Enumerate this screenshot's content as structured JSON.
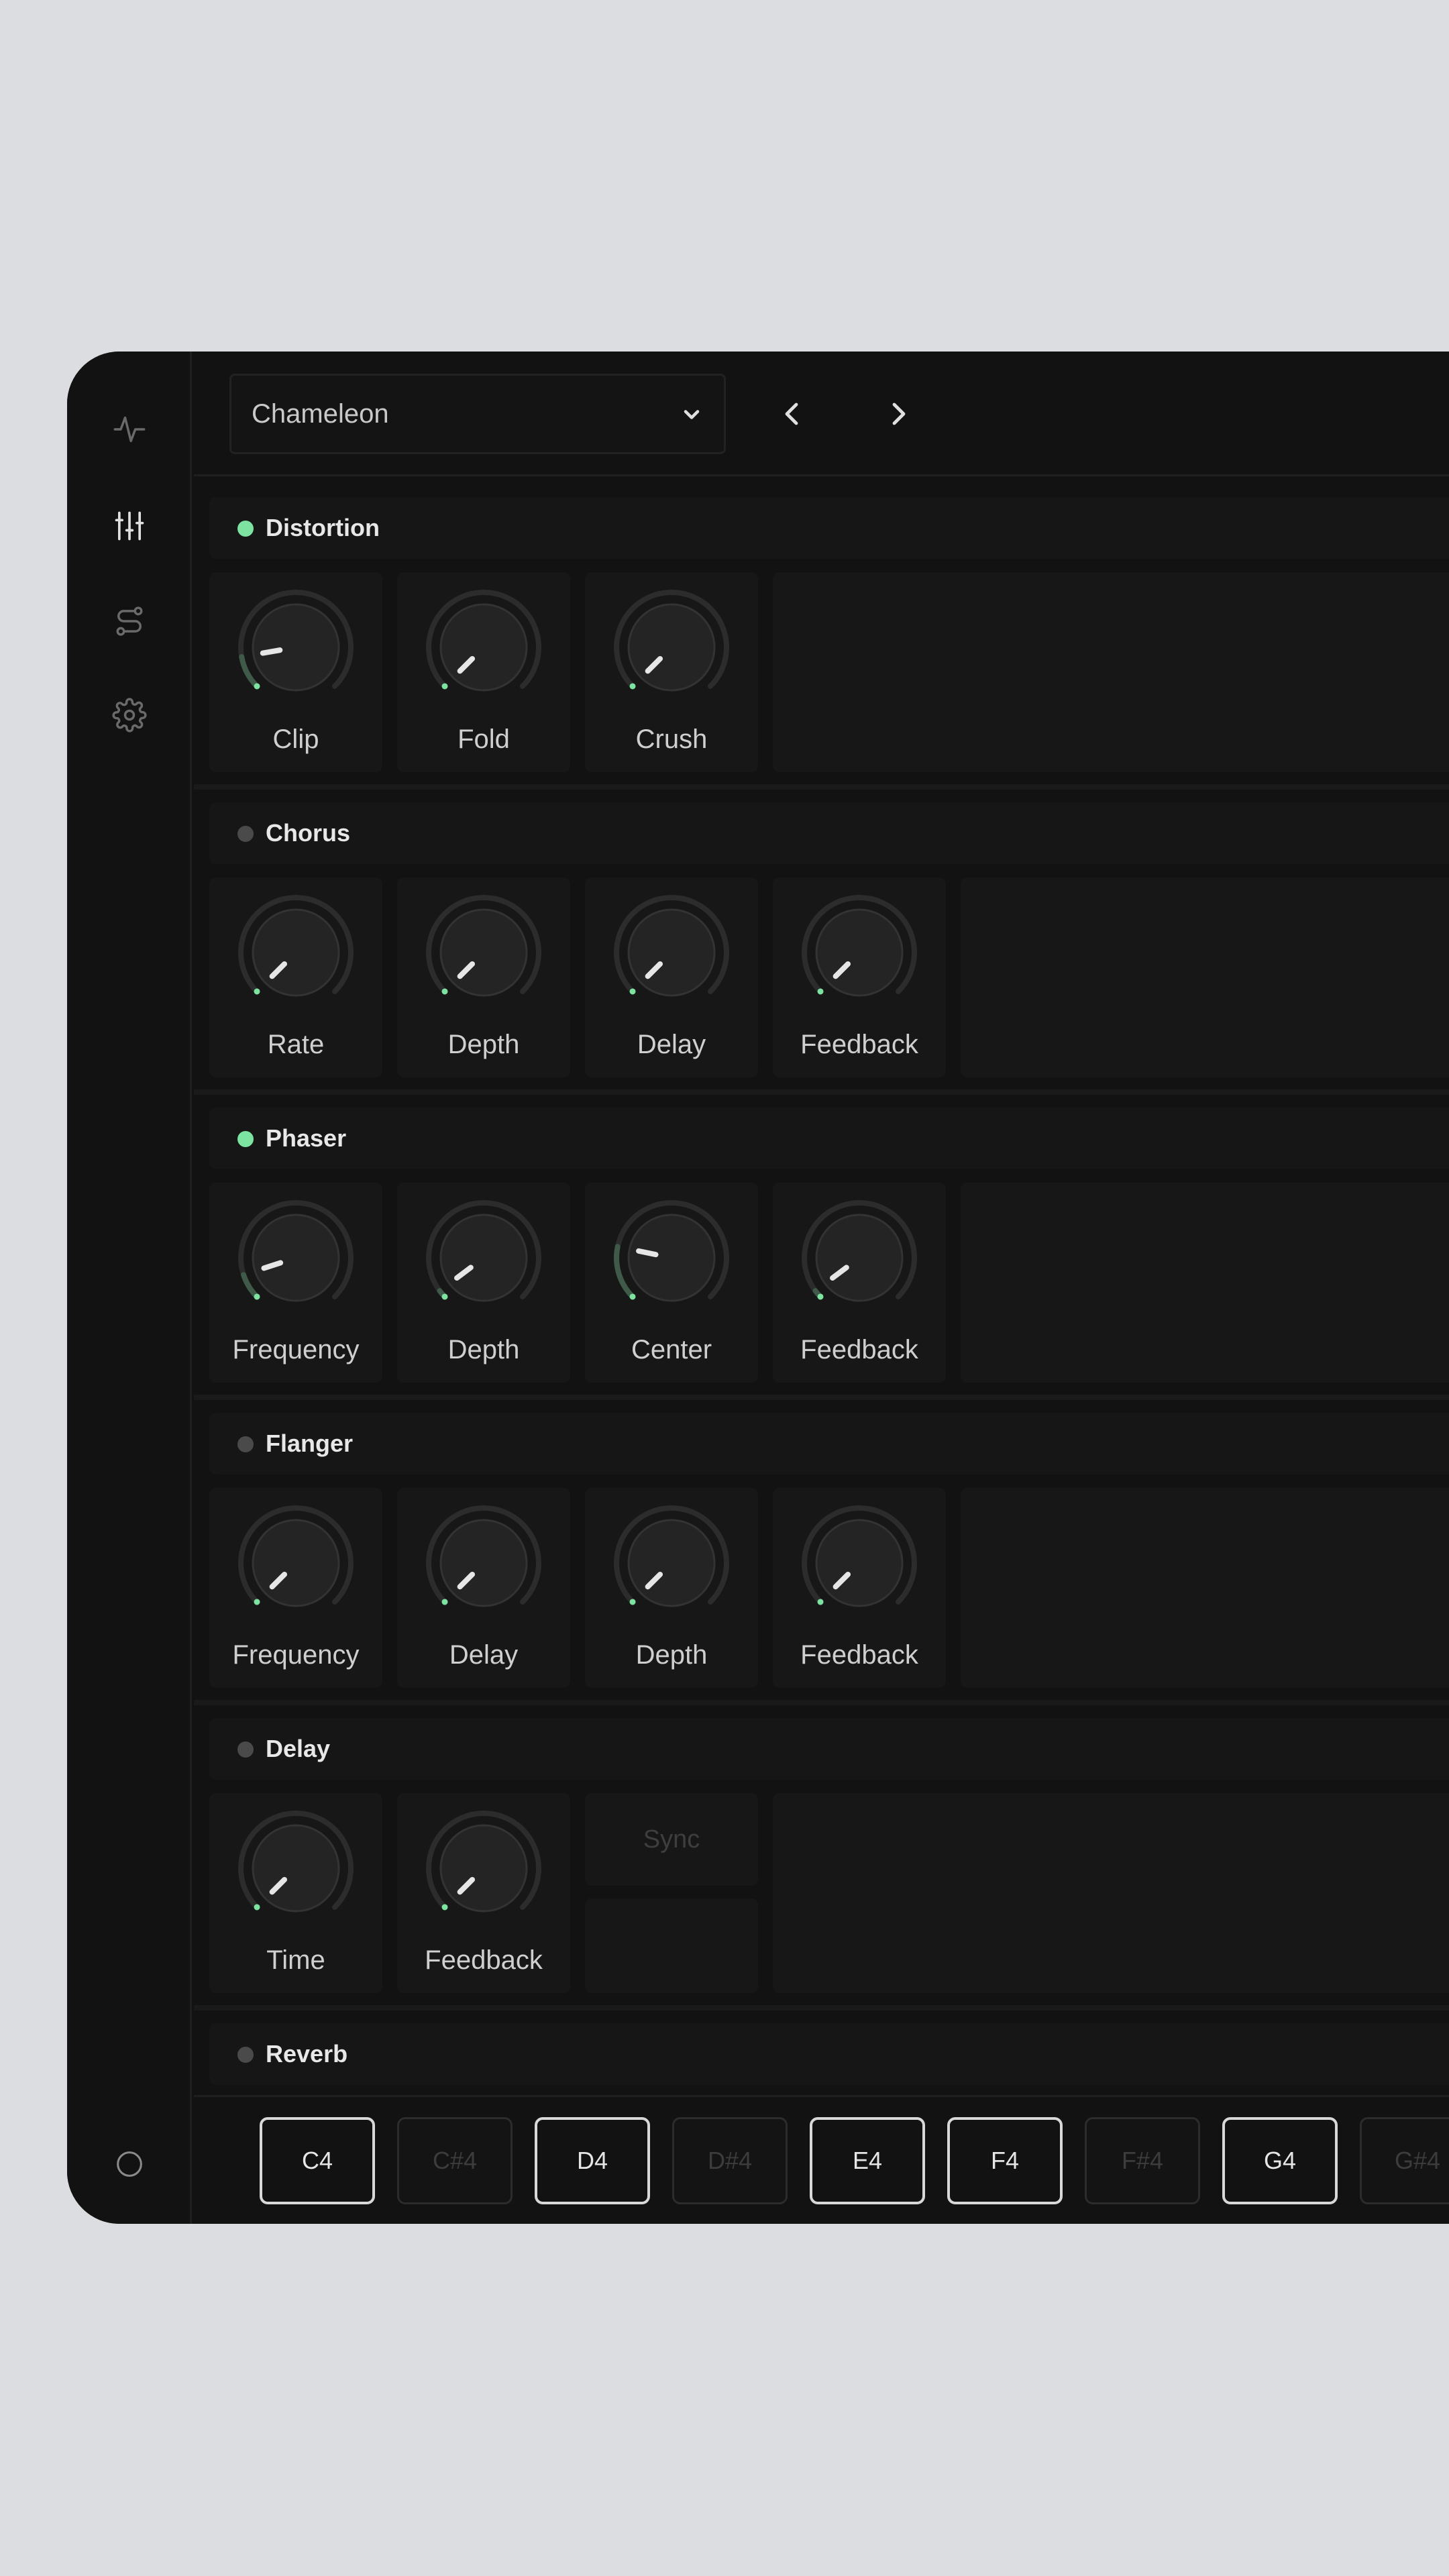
{
  "preset": {
    "name": "Chameleon"
  },
  "sidebar": {
    "icons": [
      "waveform-icon",
      "sliders-icon",
      "route-icon",
      "gear-icon",
      "power-icon"
    ]
  },
  "colors": {
    "active": "#7de3a0",
    "inactive": "#4a4a4a",
    "background": "#121212",
    "panel": "#171717"
  },
  "sections": [
    {
      "title": "Distortion",
      "enabled": true,
      "knobs": [
        {
          "label": "Clip",
          "value": 0.13
        },
        {
          "label": "Fold",
          "value": 0.0
        },
        {
          "label": "Crush",
          "value": 0.0
        }
      ]
    },
    {
      "title": "Chorus",
      "enabled": false,
      "knobs": [
        {
          "label": "Rate",
          "value": 0.0
        },
        {
          "label": "Depth",
          "value": 0.0
        },
        {
          "label": "Delay",
          "value": 0.0
        },
        {
          "label": "Feedback",
          "value": 0.0
        }
      ]
    },
    {
      "title": "Phaser",
      "enabled": true,
      "knobs": [
        {
          "label": "Frequency",
          "value": 0.1
        },
        {
          "label": "Depth",
          "value": 0.03
        },
        {
          "label": "Center",
          "value": 0.21
        },
        {
          "label": "Feedback",
          "value": 0.03
        }
      ]
    },
    {
      "title": "Flanger",
      "enabled": false,
      "knobs": [
        {
          "label": "Frequency",
          "value": 0.0
        },
        {
          "label": "Delay",
          "value": 0.0
        },
        {
          "label": "Depth",
          "value": 0.0
        },
        {
          "label": "Feedback",
          "value": 0.0
        }
      ]
    },
    {
      "title": "Delay",
      "enabled": false,
      "knobs": [
        {
          "label": "Time",
          "value": 0.0
        },
        {
          "label": "Feedback",
          "value": 0.0
        }
      ],
      "sync_label": "Sync"
    },
    {
      "title": "Reverb",
      "enabled": false,
      "knobs": []
    }
  ],
  "keys": [
    {
      "label": "C4",
      "black": false
    },
    {
      "label": "C#4",
      "black": true
    },
    {
      "label": "D4",
      "black": false
    },
    {
      "label": "D#4",
      "black": true
    },
    {
      "label": "E4",
      "black": false
    },
    {
      "label": "F4",
      "black": false
    },
    {
      "label": "F#4",
      "black": true
    },
    {
      "label": "G4",
      "black": false
    },
    {
      "label": "G#4",
      "black": true
    }
  ]
}
